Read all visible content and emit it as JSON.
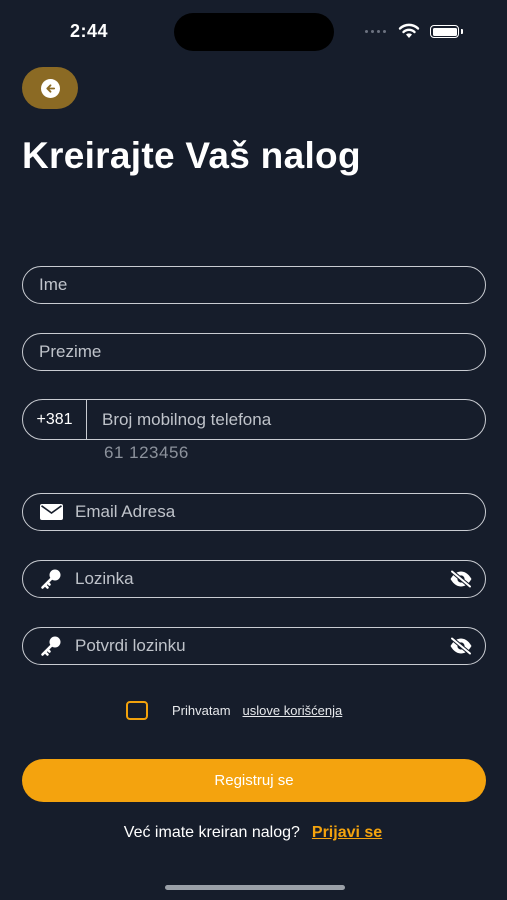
{
  "status_bar": {
    "time": "2:44"
  },
  "header": {
    "title": "Kreirajte Vaš nalog"
  },
  "form": {
    "first_name_placeholder": "Ime",
    "last_name_placeholder": "Prezime",
    "phone_prefix": "+381",
    "phone_placeholder": "Broj mobilnog telefona",
    "phone_hint": "61 123456",
    "email_placeholder": "Email Adresa",
    "password_placeholder": "Lozinka",
    "confirm_password_placeholder": "Potvrdi lozinku"
  },
  "terms": {
    "text": "Prihvatam",
    "link": "uslove korišćenja"
  },
  "submit": {
    "label": "Registruj se"
  },
  "login": {
    "question": "Već imate kreiran nalog?",
    "link": "Prijavi se"
  },
  "icons": {
    "back": "arrow-left-icon",
    "email": "envelope-icon",
    "password": "key-icon",
    "visibility": "eye-off-icon"
  },
  "colors": {
    "background": "#161d2b",
    "accent": "#f4a30e",
    "back_button": "#8b6a24",
    "border": "#c9ccd2"
  }
}
